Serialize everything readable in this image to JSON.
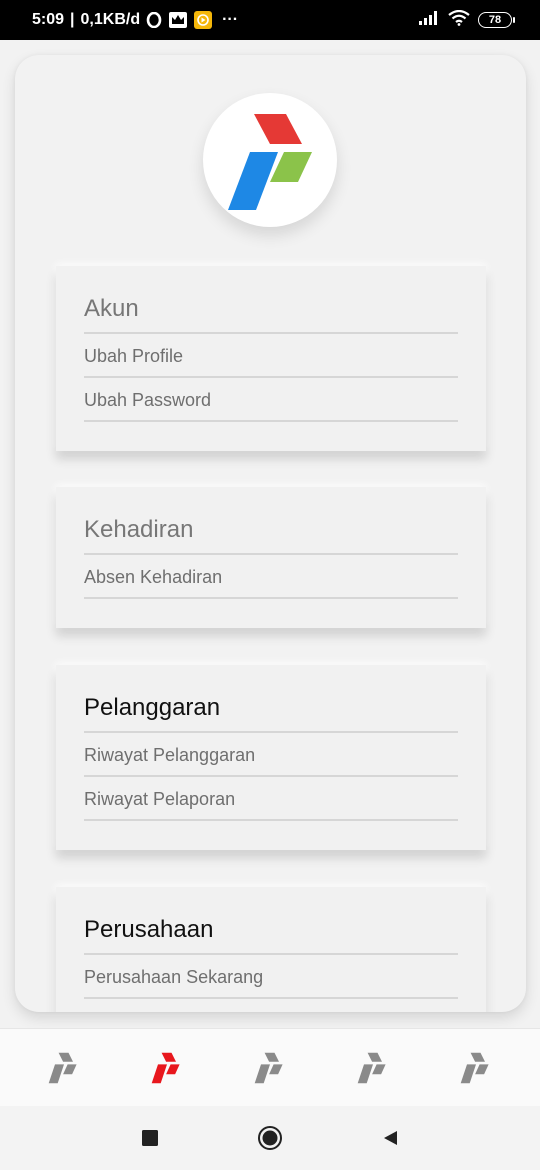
{
  "status_bar": {
    "time": "5:09",
    "separator": "|",
    "speed": "0,1KB/d",
    "battery": "78",
    "more": "···"
  },
  "colors": {
    "logo_red": "#e53935",
    "logo_green": "#8bc34a",
    "logo_blue": "#1e88e5",
    "nav_active": "#e8171d",
    "nav_inactive": "#8a8a8a"
  },
  "menu": {
    "account": {
      "title": "Akun",
      "items": [
        "Ubah Profile",
        "Ubah Password"
      ]
    },
    "attendance": {
      "title": "Kehadiran",
      "items": [
        "Absen Kehadiran"
      ]
    },
    "violation": {
      "title": "Pelanggaran",
      "items": [
        "Riwayat Pelanggaran",
        "Riwayat Pelaporan"
      ]
    },
    "company": {
      "title": "Perusahaan",
      "items": [
        "Perusahaan Sekarang"
      ]
    }
  },
  "bottom_nav": {
    "items": [
      {
        "icon": "pertamina-logo-icon",
        "active": false
      },
      {
        "icon": "pertamina-logo-icon",
        "active": true
      },
      {
        "icon": "pertamina-logo-icon",
        "active": false
      },
      {
        "icon": "pertamina-logo-icon",
        "active": false
      },
      {
        "icon": "pertamina-logo-icon",
        "active": false
      }
    ]
  },
  "system_nav": {
    "icons": [
      "recent-apps-icon",
      "home-icon",
      "back-icon"
    ]
  }
}
